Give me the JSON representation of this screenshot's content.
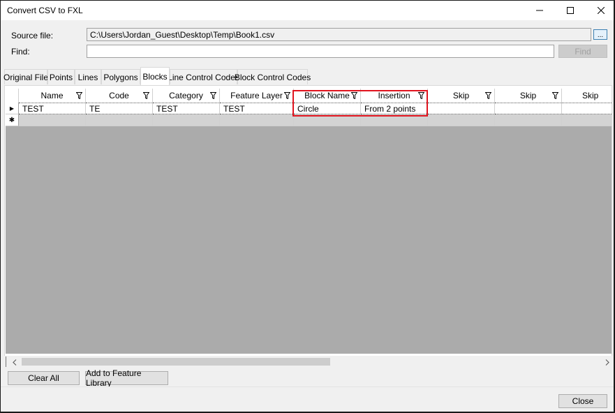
{
  "window": {
    "title": "Convert CSV to FXL"
  },
  "source": {
    "label": "Source file:",
    "value": "C:\\Users\\Jordan_Guest\\Desktop\\Temp\\Book1.csv",
    "browse_label": "..."
  },
  "find": {
    "label": "Find:",
    "value": "",
    "button_label": "Find"
  },
  "tabs": [
    {
      "label": "Original File"
    },
    {
      "label": "Points"
    },
    {
      "label": "Lines"
    },
    {
      "label": "Polygons"
    },
    {
      "label": "Blocks"
    },
    {
      "label": "Line Control Codes"
    },
    {
      "label": "Block Control Codes"
    }
  ],
  "active_tab": "Blocks",
  "grid": {
    "columns": [
      "Name",
      "Code",
      "Category",
      "Feature Layer",
      "Block Name",
      "Insertion",
      "Skip",
      "Skip",
      "Skip"
    ],
    "rows": [
      [
        "TEST",
        "TE",
        "TEST",
        "TEST",
        "Circle",
        "From 2 points",
        "",
        "",
        ""
      ]
    ],
    "current_row_marker": "▶",
    "new_row_marker": "✱"
  },
  "buttons": {
    "clear_all": "Clear All",
    "add_to_library": "Add to Feature Library",
    "close": "Close"
  },
  "colors": {
    "highlight": "#e0141e"
  }
}
